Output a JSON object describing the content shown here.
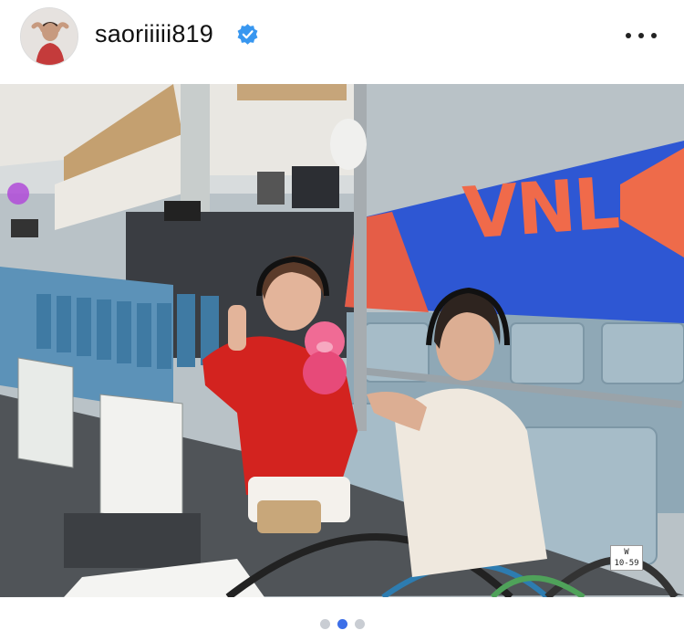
{
  "post": {
    "username": "saoriiiii819",
    "verified": true,
    "more_icon": "more-horizontal-icon",
    "accent_color": "#3897f0"
  },
  "photo": {
    "banner_text": "VNL",
    "seat_tag": "W\n10-59"
  },
  "carousel": {
    "count": 3,
    "active_index": 1,
    "active_color": "#3d6fe8",
    "inactive_color": "#c9cdd3"
  }
}
